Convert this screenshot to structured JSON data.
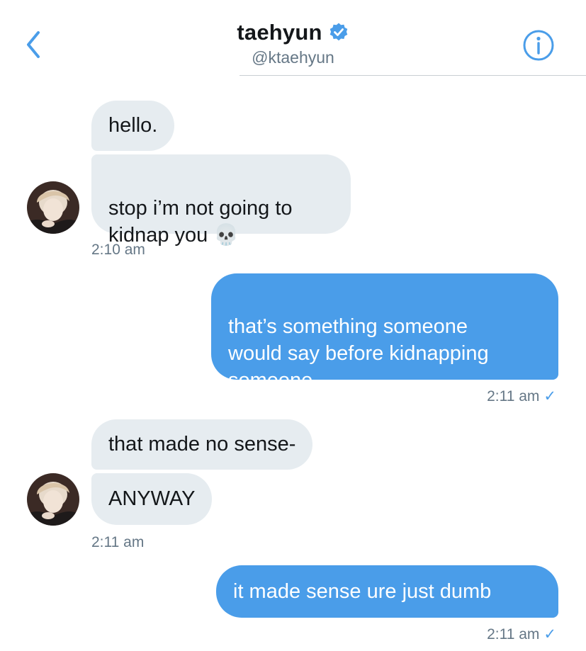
{
  "header": {
    "title": "taehyun",
    "handle": "@ktaehyun"
  },
  "messages": [
    {
      "text": "hello."
    },
    {
      "text": "stop i’m not going to\nkidnap you 💀"
    },
    {
      "text": "that’s something someone\nwould say before kidnapping\nsomeone ...."
    },
    {
      "text": "that made no sense-"
    },
    {
      "text": "ANYWAY"
    },
    {
      "text": "it made sense ure just dumb"
    }
  ],
  "timestamps": [
    "2:10 am",
    "2:11 am",
    "2:11 am",
    "2:11 am"
  ],
  "read_check": "✓",
  "colors": {
    "accent": "#4a9de9",
    "incoming_bubble": "#e6ecf0",
    "muted_text": "#657786"
  }
}
